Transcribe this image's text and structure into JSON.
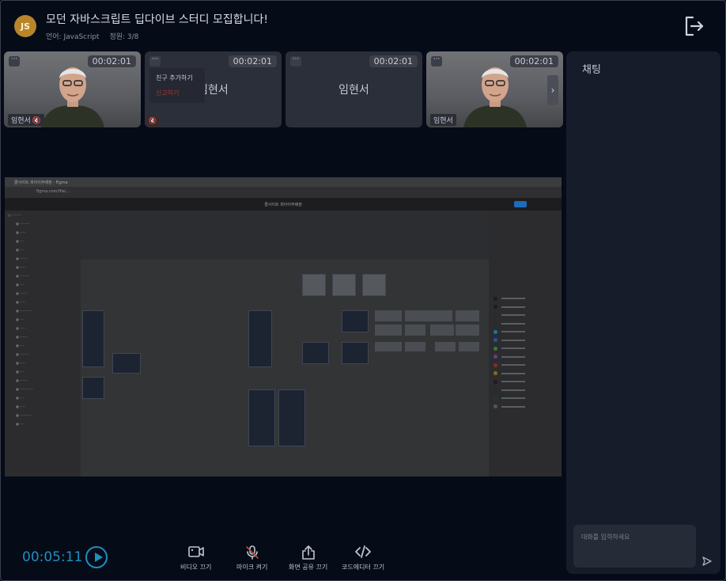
{
  "header": {
    "logo_text": "JS",
    "title": "모던 자바스크립트 딥다이브 스터디 모집합니다!",
    "language": "언어: JavaScript",
    "capacity": "정원: 3/8"
  },
  "tiles": [
    {
      "type": "video",
      "timer": "00:02:01",
      "name": "임현서",
      "muted": true
    },
    {
      "type": "name",
      "timer": "00:02:01",
      "name": "임현서"
    },
    {
      "type": "name",
      "timer": "00:02:01",
      "name": "임현서"
    },
    {
      "type": "video",
      "timer": "00:02:01",
      "name": "임현서"
    }
  ],
  "tile_menu": {
    "more": "···",
    "add_friend": "친구 추가하기",
    "report": "신고하기"
  },
  "shared_screen": {
    "tab_title": "클사이트 피아이주배정 - Figma",
    "url": "figma.com/file/...",
    "figma_title": "클사이트 피아이주배정"
  },
  "chat": {
    "title": "채팅",
    "placeholder": "대화를 입력하세요"
  },
  "controls": {
    "elapsed": "00:05:11",
    "video_off": "비디오 끄기",
    "mic_on": "마이크 켜기",
    "screen_share_off": "화면 공유 끄기",
    "code_editor_off": "코드에디터 끄기"
  },
  "colors": {
    "accent": "#1e8fc2",
    "background": "#060b18",
    "danger": "#a03a2e"
  }
}
